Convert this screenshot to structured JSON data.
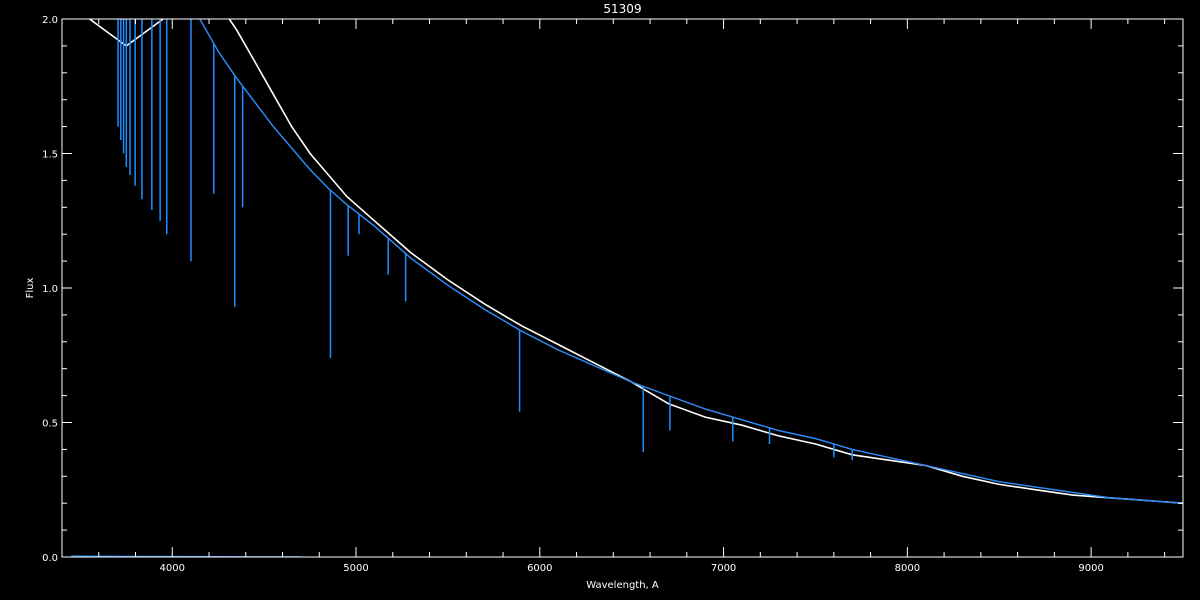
{
  "chart_data": {
    "type": "line",
    "title": "51309",
    "xlabel": "Wavelength, A",
    "ylabel": "Flux",
    "xlim": [
      3400,
      9500
    ],
    "ylim": [
      0.0,
      2.0
    ],
    "grid": false,
    "xticks": {
      "major": [
        4000,
        5000,
        6000,
        7000,
        8000,
        9000
      ],
      "labels": [
        "4000",
        "5000",
        "6000",
        "7000",
        "8000",
        "9000"
      ]
    },
    "yticks": {
      "major": [
        0.0,
        0.5,
        1.0,
        1.5,
        2.0
      ],
      "labels": [
        "0.0",
        "0.5",
        "1.0",
        "1.5",
        "2.0"
      ]
    },
    "colors": {
      "background": "#000000",
      "axes": "#ffffff",
      "observed": "#ffffff",
      "model": "#ff2222",
      "template": "#1f8fff"
    },
    "series": [
      {
        "color_key": "observed",
        "x": [
          3550,
          3650,
          3750,
          3850,
          3950,
          4050,
          4150,
          4250,
          4350,
          4450,
          4550,
          4650,
          4750,
          4850,
          4950,
          5100,
          5300,
          5500,
          5700,
          5900,
          6100,
          6300,
          6500,
          6700,
          6900,
          7100,
          7300,
          7500,
          7700,
          7900,
          8100,
          8300,
          8500,
          8700,
          8900,
          9100,
          9300,
          9500
        ],
        "y": [
          2.0,
          1.95,
          1.9,
          1.95,
          2.0,
          2.05,
          2.1,
          2.06,
          1.96,
          1.84,
          1.72,
          1.6,
          1.5,
          1.42,
          1.34,
          1.25,
          1.13,
          1.03,
          0.94,
          0.86,
          0.79,
          0.72,
          0.65,
          0.57,
          0.52,
          0.49,
          0.45,
          0.42,
          0.38,
          0.36,
          0.34,
          0.3,
          0.27,
          0.25,
          0.23,
          0.22,
          0.21,
          0.2
        ]
      },
      {
        "color_key": "model",
        "x": [
          3550,
          3650,
          3750,
          3850,
          3950,
          4050,
          4150,
          4250,
          4350,
          4450,
          4550,
          4650,
          4750,
          4850,
          4950,
          5100,
          5300,
          5500,
          5700,
          5900,
          6100,
          6300,
          6500,
          6700,
          6900,
          7100,
          7300,
          7500,
          7700,
          7900,
          8100,
          8300,
          8500,
          8700,
          8900,
          9100,
          9300,
          9500
        ],
        "y": [
          2.2,
          2.15,
          2.08,
          2.05,
          2.03,
          2.02,
          2.0,
          1.88,
          1.78,
          1.69,
          1.6,
          1.52,
          1.44,
          1.37,
          1.31,
          1.23,
          1.11,
          1.01,
          0.92,
          0.84,
          0.77,
          0.71,
          0.65,
          0.6,
          0.55,
          0.51,
          0.47,
          0.44,
          0.4,
          0.37,
          0.34,
          0.31,
          0.28,
          0.26,
          0.24,
          0.22,
          0.21,
          0.2
        ]
      },
      {
        "color_key": "template",
        "x": [
          3550,
          3650,
          3750,
          3850,
          3950,
          4050,
          4150,
          4250,
          4350,
          4450,
          4550,
          4650,
          4750,
          4850,
          4950,
          5100,
          5300,
          5500,
          5700,
          5900,
          6100,
          6300,
          6500,
          6700,
          6900,
          7100,
          7300,
          7500,
          7700,
          7900,
          8100,
          8300,
          8500,
          8700,
          8900,
          9100,
          9300,
          9500
        ],
        "y": [
          2.2,
          2.15,
          2.08,
          2.05,
          2.03,
          2.02,
          2.0,
          1.88,
          1.78,
          1.69,
          1.6,
          1.52,
          1.44,
          1.37,
          1.31,
          1.23,
          1.11,
          1.01,
          0.92,
          0.84,
          0.77,
          0.71,
          0.65,
          0.6,
          0.55,
          0.51,
          0.47,
          0.44,
          0.4,
          0.37,
          0.34,
          0.31,
          0.28,
          0.26,
          0.24,
          0.22,
          0.21,
          0.2
        ]
      },
      {
        "color_key": "template",
        "x": [
          3450,
          4700
        ],
        "y": [
          0.003,
          0.0
        ]
      }
    ],
    "absorption_lines": {
      "color_key": "template",
      "x": [
        3705,
        3720,
        3735,
        3750,
        3770,
        3798,
        3835,
        3889,
        3934,
        3970,
        4102,
        4226,
        4340,
        4383,
        4861,
        4957,
        5016,
        5175,
        5270,
        5890,
        6563,
        6708,
        7050,
        7250,
        7600,
        7700
      ],
      "depth_to_y": [
        1.6,
        1.55,
        1.5,
        1.45,
        1.42,
        1.38,
        1.33,
        1.29,
        1.25,
        1.2,
        1.1,
        1.35,
        0.93,
        1.3,
        0.74,
        1.12,
        1.2,
        1.05,
        0.95,
        0.54,
        0.39,
        0.47,
        0.43,
        0.42,
        0.37,
        0.36
      ]
    }
  }
}
